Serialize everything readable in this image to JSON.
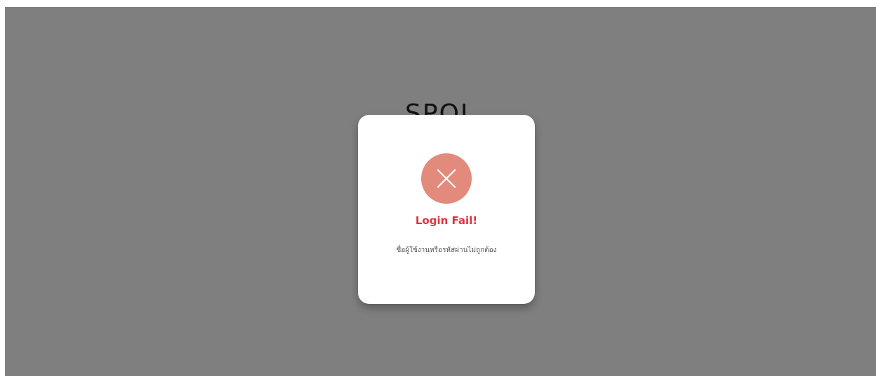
{
  "page": {
    "heading": "SPOL"
  },
  "modal": {
    "icon": "close-x-icon",
    "icon_color": "#e28a7c",
    "title": "Login Fail!",
    "title_color": "#e0313f",
    "message": "ชื่อผู้ใช้งานหรือรหัสผ่านไม่ถูกต้อง"
  }
}
